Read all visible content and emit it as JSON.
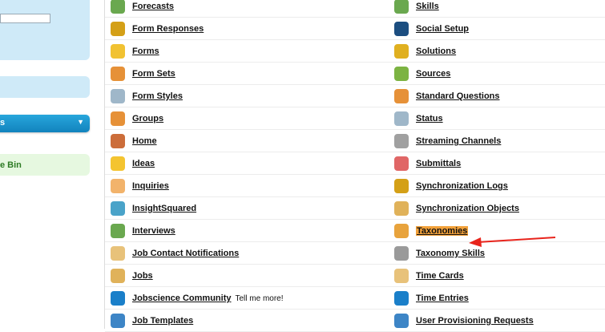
{
  "sidebar": {
    "recycle_bin_label": "e Bin",
    "dropdown_label": "s"
  },
  "colors": {
    "sidebar_box": "#cfeaf8",
    "dropdown": "#1a92cc",
    "recycle_bin": "#e6f8e0",
    "highlight": "#f2a13a",
    "annotation_arrow": "#e8241c"
  },
  "tabs_left": [
    {
      "label": "Forecasts",
      "icon": "forecasts-icon",
      "color": "#6aa84f"
    },
    {
      "label": "Form Responses",
      "icon": "form-responses-icon",
      "color": "#d4a017"
    },
    {
      "label": "Forms",
      "icon": "forms-icon",
      "color": "#f1c232"
    },
    {
      "label": "Form Sets",
      "icon": "form-sets-icon",
      "color": "#e69138"
    },
    {
      "label": "Form Styles",
      "icon": "form-styles-icon",
      "color": "#9fb7c9"
    },
    {
      "label": "Groups",
      "icon": "groups-icon",
      "color": "#e69138"
    },
    {
      "label": "Home",
      "icon": "home-icon",
      "color": "#cc6d3a"
    },
    {
      "label": "Ideas",
      "icon": "ideas-icon",
      "color": "#f4c430"
    },
    {
      "label": "Inquiries",
      "icon": "inquiries-icon",
      "color": "#f2b36b"
    },
    {
      "label": "InsightSquared",
      "icon": "insightsquared-icon",
      "color": "#4aa3c9"
    },
    {
      "label": "Interviews",
      "icon": "interviews-icon",
      "color": "#6aa84f"
    },
    {
      "label": "Job Contact Notifications",
      "icon": "job-contact-notifications-icon",
      "color": "#e8c27a"
    },
    {
      "label": "Jobs",
      "icon": "jobs-icon",
      "color": "#e0b25a"
    },
    {
      "label": "Jobscience Community",
      "icon": "jobscience-community-icon",
      "color": "#1a7fc9",
      "extra": "Tell me more!"
    },
    {
      "label": "Job Templates",
      "icon": "job-templates-icon",
      "color": "#3d85c6"
    }
  ],
  "tabs_right": [
    {
      "label": "Skills",
      "icon": "skills-icon",
      "color": "#6aa84f"
    },
    {
      "label": "Social Setup",
      "icon": "social-setup-icon",
      "color": "#1c4e80"
    },
    {
      "label": "Solutions",
      "icon": "solutions-icon",
      "color": "#e0b020"
    },
    {
      "label": "Sources",
      "icon": "sources-icon",
      "color": "#7cb342"
    },
    {
      "label": "Standard Questions",
      "icon": "standard-questions-icon",
      "color": "#e69138"
    },
    {
      "label": "Status",
      "icon": "status-icon",
      "color": "#9fb7c9"
    },
    {
      "label": "Streaming Channels",
      "icon": "streaming-channels-icon",
      "color": "#a0a0a0"
    },
    {
      "label": "Submittals",
      "icon": "submittals-icon",
      "color": "#e06666"
    },
    {
      "label": "Synchronization Logs",
      "icon": "synchronization-logs-icon",
      "color": "#d4a017"
    },
    {
      "label": "Synchronization Objects",
      "icon": "synchronization-objects-icon",
      "color": "#e0b25a"
    },
    {
      "label": "Taxonomies",
      "icon": "taxonomies-icon",
      "color": "#e8a33c",
      "highlight": true
    },
    {
      "label": "Taxonomy Skills",
      "icon": "taxonomy-skills-icon",
      "color": "#9a9a9a"
    },
    {
      "label": "Time Cards",
      "icon": "time-cards-icon",
      "color": "#e8c27a"
    },
    {
      "label": "Time Entries",
      "icon": "time-entries-icon",
      "color": "#1a7fc9"
    },
    {
      "label": "User Provisioning Requests",
      "icon": "user-provisioning-requests-icon",
      "color": "#3d85c6"
    }
  ]
}
